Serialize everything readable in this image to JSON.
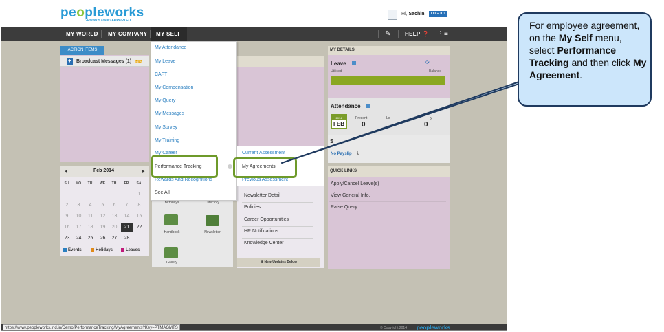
{
  "header": {
    "logo_main": "peopleworks",
    "logo_part1": "pe",
    "logo_accent": "o",
    "logo_part2": "pleworks",
    "tagline": "GROWTH.UNINTERRUPTED",
    "greeting_prefix": "Hi,",
    "user_name": "Sachin",
    "logout_label": "LOGOUT"
  },
  "nav": {
    "tabs": [
      {
        "label": "MY WORLD"
      },
      {
        "label": "MY COMPANY"
      },
      {
        "label": "MY SELF"
      }
    ],
    "help_label": "HELP"
  },
  "action_items": {
    "tab_label": "ACTION ITEMS",
    "broadcast_label": "Broadcast Messages (1)",
    "new_badge": "NEW"
  },
  "my_details": {
    "title": "MY DETAILS",
    "leave_title": "Leave",
    "utilised_label": "Utilised",
    "balance_label": "Balance",
    "attendance_title": "Attendance",
    "cal_year": "2014",
    "cal_month": "FEB",
    "present_label": "Present",
    "present_value": "0",
    "other_value": "0",
    "le_label": "Le",
    "ay_label": "y",
    "payslip_prefix": "S",
    "payslip_label": "No Payslip"
  },
  "calendar": {
    "title": "Feb 2014",
    "prev": "◂",
    "next": "▸",
    "dows": [
      "SU",
      "MO",
      "TU",
      "WE",
      "TH",
      "FR",
      "SA"
    ],
    "rows": [
      [
        "",
        "",
        "",
        "",
        "",
        "",
        "1"
      ],
      [
        "2",
        "3",
        "4",
        "5",
        "6",
        "7",
        "8"
      ],
      [
        "9",
        "10",
        "11",
        "12",
        "13",
        "14",
        "15"
      ],
      [
        "16",
        "17",
        "18",
        "19",
        "20",
        "21",
        "22"
      ],
      [
        "23",
        "24",
        "25",
        "26",
        "27",
        "28",
        ""
      ]
    ],
    "today": "21",
    "legend": [
      {
        "label": "Events",
        "color": "#2a7fc0"
      },
      {
        "label": "Holidays",
        "color": "#e08a1a"
      },
      {
        "label": "Leaves",
        "color": "#c0187a"
      }
    ]
  },
  "apps": {
    "birthdays": "Birthdays",
    "directory": "Directory",
    "handbook": "Handbook",
    "newsletter": "Newsletter",
    "gallery": "Gallery"
  },
  "mid_links": {
    "items": [
      "Newsletter Detail",
      "Policies",
      "Career Opportunities",
      "HR Notifications",
      "Knowledge Center"
    ],
    "new_updates": "New Updates Below"
  },
  "quick_links": {
    "title": "QUICK LINKS",
    "items": [
      "Apply/Cancel Leave(s)",
      "View General Info.",
      "Raise Query"
    ]
  },
  "dropdown": {
    "items": [
      "My Attendance",
      "My Leave",
      "CAFT",
      "My Compensation",
      "My Query",
      "My Messages",
      "My Survey",
      "My Training",
      "My Career",
      "Performance Tracking",
      "Rewards And Recognitions",
      "See All"
    ],
    "submenu": [
      "Current Assessment",
      "My Agreements",
      "Previous Assessment"
    ]
  },
  "status": {
    "url": "https://www.peopleworks.ind.in/Demo/PerformanceTracking/MyAgreements?Key=PTMAGMTS",
    "copyright": "© Copyright 2014",
    "footer_logo": "peopleworks"
  },
  "callout": {
    "t1": "For employee agreement, on the ",
    "b1": "My Self",
    "t2": " menu, select ",
    "b2": "Performance Tracking",
    "t3": " and then click ",
    "b3": "My Agreement",
    "t4": "."
  },
  "colors": {
    "accent_blue": "#2a9bd6",
    "highlight_green": "#6e9a2a",
    "nav_dark": "#3c3c3c",
    "callout_fill": "#cce6fb"
  }
}
